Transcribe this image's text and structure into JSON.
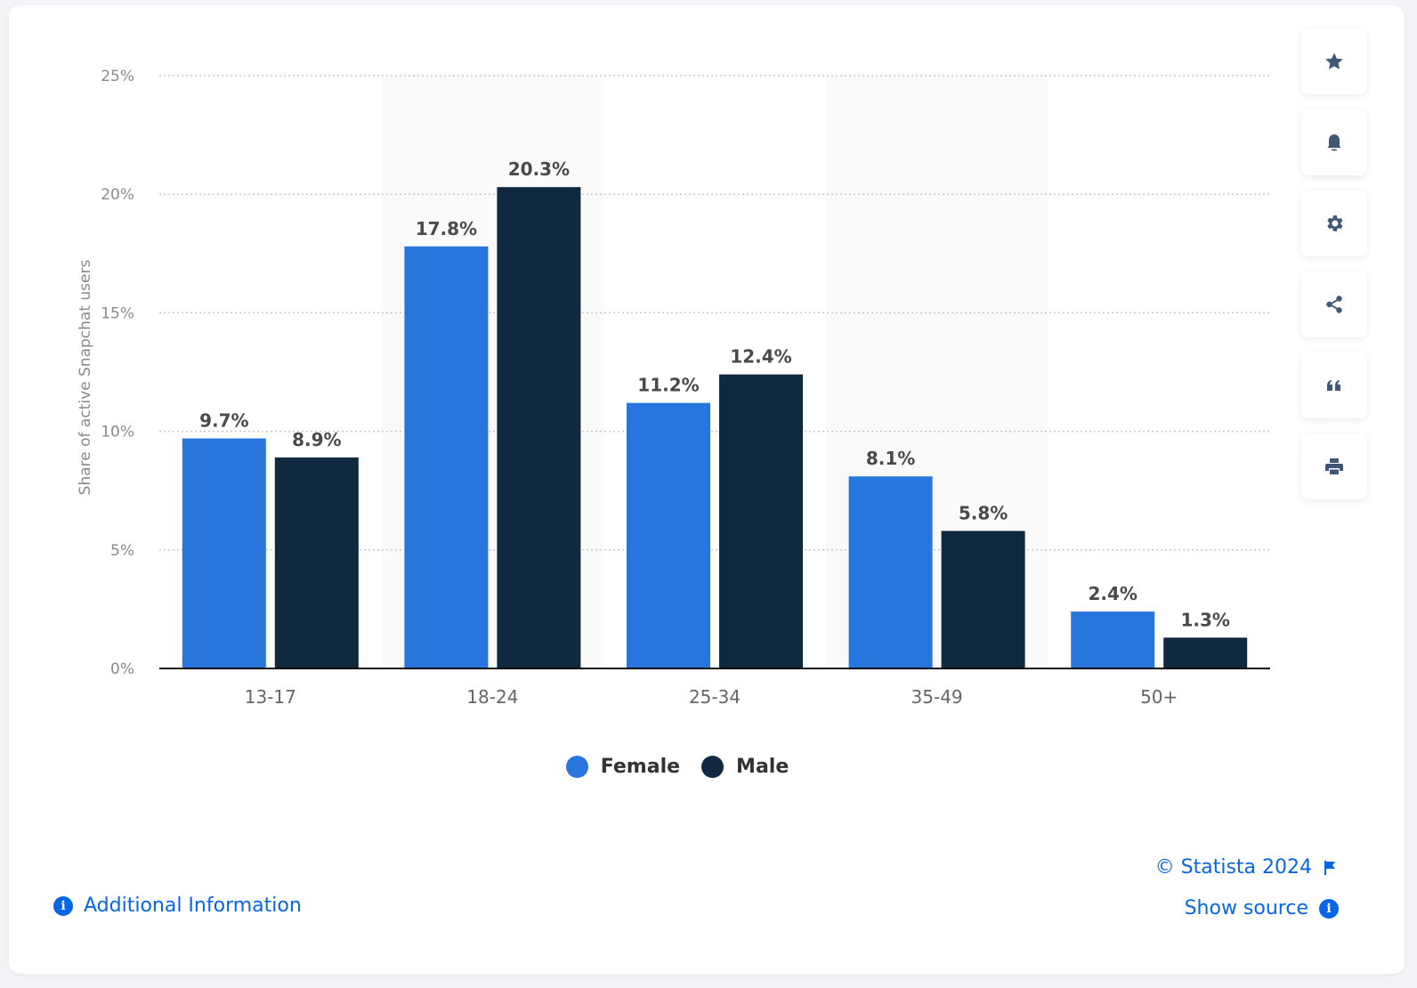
{
  "chart_data": {
    "type": "bar",
    "title": "",
    "xlabel": "",
    "ylabel": "Share of active Snapchat users",
    "categories": [
      "13-17",
      "18-24",
      "25-34",
      "35-49",
      "50+"
    ],
    "series": [
      {
        "name": "Female",
        "color": "#2876dd",
        "values": [
          9.7,
          17.8,
          11.2,
          8.1,
          2.4
        ]
      },
      {
        "name": "Male",
        "color": "#0f2a40",
        "values": [
          8.9,
          20.3,
          12.4,
          5.8,
          1.3
        ]
      }
    ],
    "data_labels": [
      [
        "9.7%",
        "17.8%",
        "11.2%",
        "8.1%",
        "2.4%"
      ],
      [
        "8.9%",
        "20.3%",
        "12.4%",
        "5.8%",
        "1.3%"
      ]
    ],
    "ylim": [
      0,
      25
    ],
    "yticks": [
      0,
      5,
      10,
      15,
      20,
      25
    ],
    "ytick_labels": [
      "0%",
      "5%",
      "10%",
      "15%",
      "20%",
      "25%"
    ],
    "grid": true,
    "legend": "bottom-center"
  },
  "legend": {
    "items": [
      {
        "label": "Female",
        "color": "#2876dd"
      },
      {
        "label": "Male",
        "color": "#0f2a40"
      }
    ]
  },
  "toolbar": {
    "buttons": [
      {
        "name": "favorite",
        "icon": "star-icon"
      },
      {
        "name": "notification",
        "icon": "bell-icon"
      },
      {
        "name": "settings",
        "icon": "gear-icon"
      },
      {
        "name": "share",
        "icon": "share-icon"
      },
      {
        "name": "cite",
        "icon": "quote-icon"
      },
      {
        "name": "print",
        "icon": "printer-icon"
      }
    ]
  },
  "footer": {
    "additional_info": "Additional Information",
    "copyright": "© Statista 2024",
    "show_source": "Show source"
  }
}
